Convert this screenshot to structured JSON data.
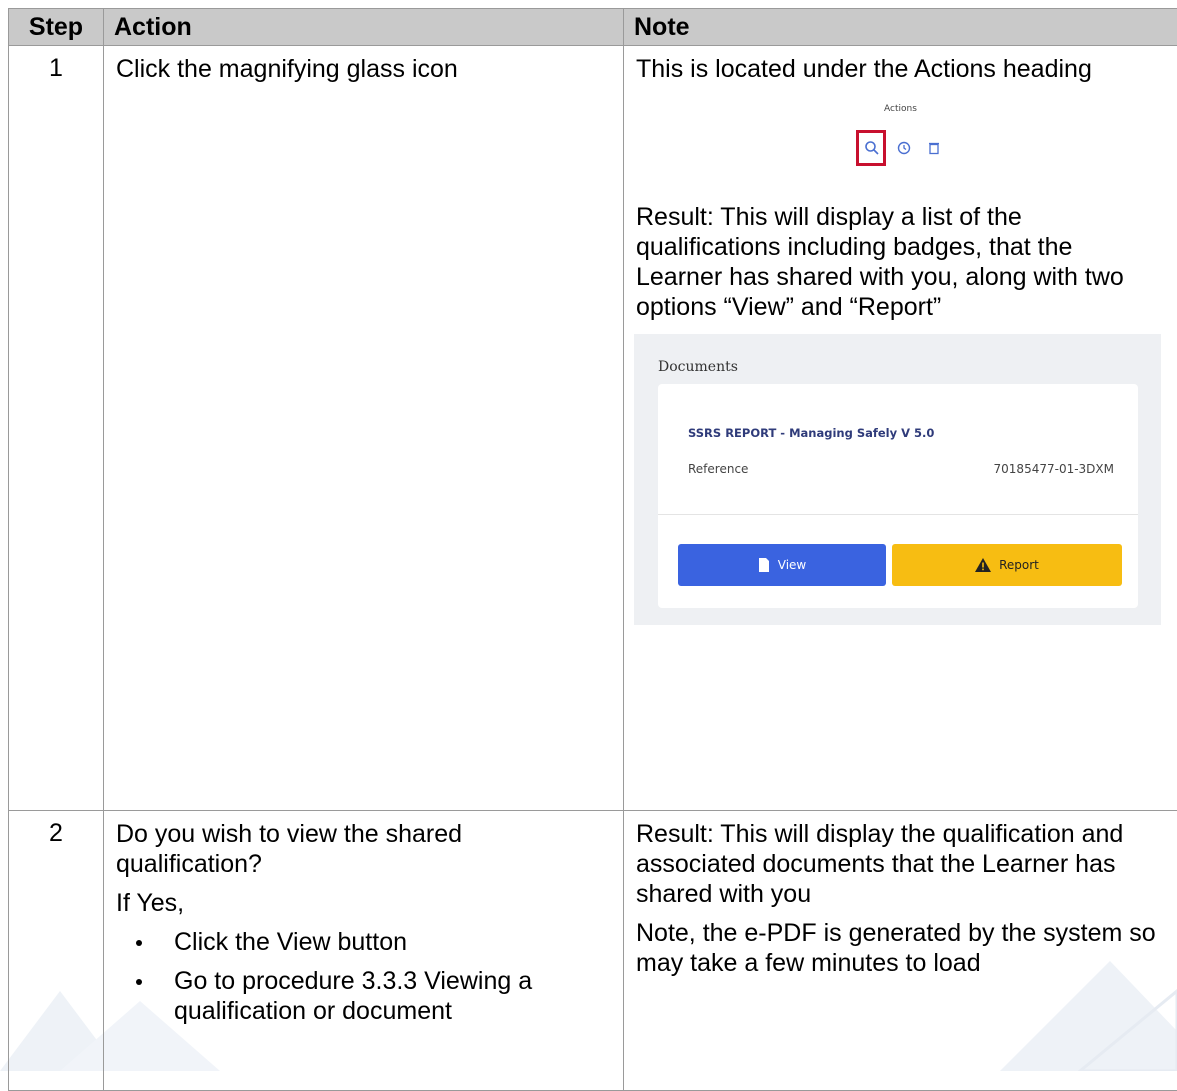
{
  "table": {
    "headers": {
      "step": "Step",
      "action": "Action",
      "note": "Note"
    },
    "row1": {
      "step": "1",
      "action": "Click the magnifying glass icon",
      "note_intro": "This is located under the Actions heading",
      "actions_image": {
        "heading": "Actions",
        "icons": [
          "magnifying-glass-icon",
          "history-icon",
          "trash-icon"
        ],
        "highlight_color": "#c8102e"
      },
      "note_result": "Result: This will display a list of the qualifications including badges, that the Learner has shared with you, along with two options “View” and “Report”",
      "documents_image": {
        "title": "Documents",
        "card_title": "SSRS REPORT - Managing Safely V 5.0",
        "reference_label": "Reference",
        "reference_value": "70185477-01-3DXM",
        "view_label": "View",
        "report_label": "Report",
        "view_color": "#3a63e0",
        "report_color": "#f7bd12"
      }
    },
    "row2": {
      "step": "2",
      "action_question": "Do you wish to view the shared qualification?",
      "action_if_yes": "If Yes,",
      "action_bullets": [
        "Click the View button",
        "Go to procedure 3.3.3 Viewing a qualification or document"
      ],
      "note_result": "Result: This will display the qualification and associated documents that the Learner has shared with you",
      "note_extra": "Note, the e-PDF is generated by the system so may take a few minutes to load"
    }
  }
}
